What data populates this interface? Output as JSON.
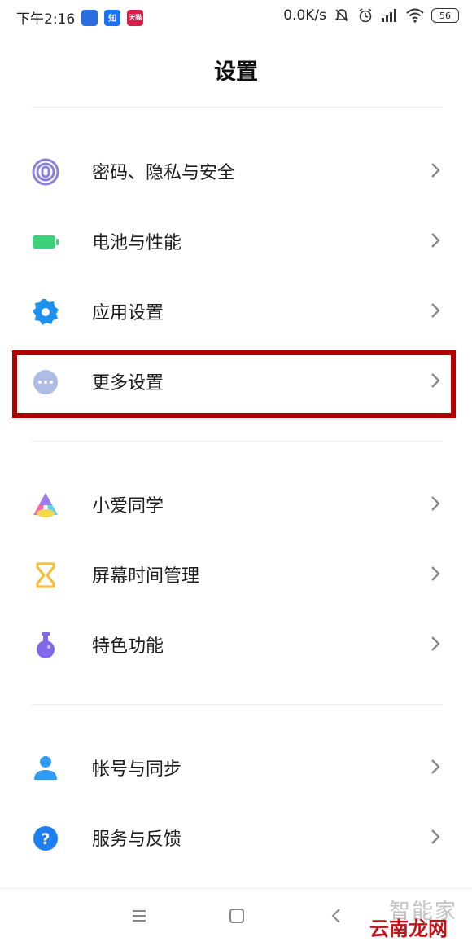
{
  "status_bar": {
    "time": "下午2:16",
    "apps": [
      {
        "icon": "app-icon-1",
        "text": "",
        "color": "#2b6de0"
      },
      {
        "icon": "zhihu-icon",
        "text": "知",
        "color": "#1772f6"
      },
      {
        "icon": "tmall-icon",
        "text": "天猫",
        "color": "#d6204b"
      }
    ],
    "net_speed": "0.0K/s",
    "battery": "56"
  },
  "page": {
    "title": "设置"
  },
  "groups": [
    {
      "items": [
        {
          "label": "密码、隐私与安全",
          "icon": "fingerprint-icon"
        },
        {
          "label": "电池与性能",
          "icon": "battery-icon"
        },
        {
          "label": "应用设置",
          "icon": "gear-icon"
        },
        {
          "label": "更多设置",
          "icon": "more-dots-icon",
          "highlighted": true
        }
      ]
    },
    {
      "items": [
        {
          "label": "小爱同学",
          "icon": "xiaoai-icon"
        },
        {
          "label": "屏幕时间管理",
          "icon": "hourglass-icon"
        },
        {
          "label": "特色功能",
          "icon": "flask-icon"
        }
      ]
    },
    {
      "items": [
        {
          "label": "帐号与同步",
          "icon": "account-icon"
        },
        {
          "label": "服务与反馈",
          "icon": "help-icon"
        }
      ]
    }
  ],
  "watermark": {
    "top_text": "智能家",
    "bottom_text": "云南龙网"
  },
  "colors": {
    "highlight": "#b10000",
    "accent_green": "#3fd07a",
    "accent_blue": "#1e90f0"
  }
}
